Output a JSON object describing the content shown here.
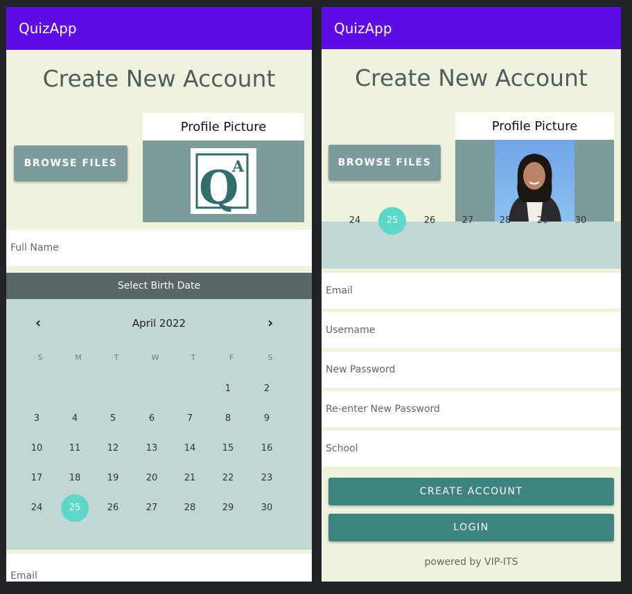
{
  "app_title": "QuizApp",
  "heading": "Create New Account",
  "browse_label": "BROWSE FILES",
  "profile_picture_label": "Profile Picture",
  "logo": {
    "letter_big": "Q",
    "letter_small": "A"
  },
  "fields": {
    "full_name": "Full Name",
    "email": "Email",
    "username": "Username",
    "new_password": "New Password",
    "reenter_password": "Re-enter New Password",
    "school": "School"
  },
  "calendar": {
    "header": "Select Birth Date",
    "month": "April 2022",
    "prev": "‹",
    "next": "›",
    "weekdays": [
      "S",
      "M",
      "T",
      "W",
      "T",
      "F",
      "S"
    ],
    "weeks": [
      [
        "",
        "",
        "",
        "",
        "",
        "1",
        "2"
      ],
      [
        "3",
        "4",
        "5",
        "6",
        "7",
        "8",
        "9"
      ],
      [
        "10",
        "11",
        "12",
        "13",
        "14",
        "15",
        "16"
      ],
      [
        "17",
        "18",
        "19",
        "20",
        "21",
        "22",
        "23"
      ],
      [
        "24",
        "25",
        "26",
        "27",
        "28",
        "29",
        "30"
      ]
    ],
    "selected": "25"
  },
  "buttons": {
    "create_account": "CREATE ACCOUNT",
    "login": "LOGIN"
  },
  "footer": "powered by VIP-ITS",
  "colors": {
    "app_bar": "#5e0ce6",
    "background": "#eff2dd",
    "button_teal": "#3d8480",
    "selected_day": "#5dd8c8"
  }
}
